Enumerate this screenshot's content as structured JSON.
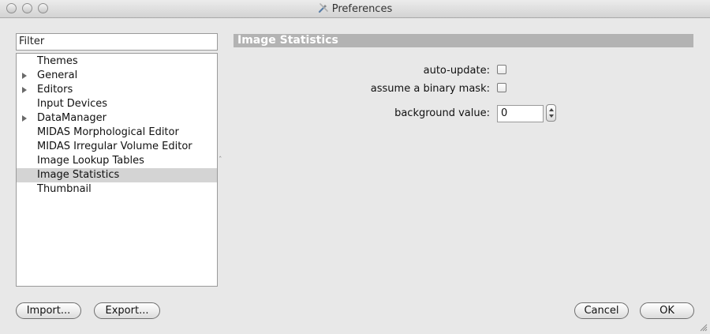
{
  "window": {
    "title": "Preferences"
  },
  "sidebar": {
    "filter_placeholder": "Filter",
    "items": [
      {
        "label": "Themes",
        "expandable": false,
        "selected": false
      },
      {
        "label": "General",
        "expandable": true,
        "selected": false
      },
      {
        "label": "Editors",
        "expandable": true,
        "selected": false
      },
      {
        "label": "Input Devices",
        "expandable": false,
        "selected": false
      },
      {
        "label": "DataManager",
        "expandable": true,
        "selected": false
      },
      {
        "label": "MIDAS Morphological Editor",
        "expandable": false,
        "selected": false
      },
      {
        "label": "MIDAS Irregular Volume Editor",
        "expandable": false,
        "selected": false
      },
      {
        "label": "Image Lookup Tables",
        "expandable": false,
        "selected": false
      },
      {
        "label": "Image Statistics",
        "expandable": false,
        "selected": true
      },
      {
        "label": "Thumbnail",
        "expandable": false,
        "selected": false
      }
    ]
  },
  "panel": {
    "title": "Image Statistics",
    "auto_update_label": "auto-update:",
    "auto_update_checked": false,
    "binary_mask_label": "assume a binary mask:",
    "binary_mask_checked": false,
    "background_value_label": "background value:",
    "background_value": "0"
  },
  "footer": {
    "import_label": "Import...",
    "export_label": "Export...",
    "cancel_label": "Cancel",
    "ok_label": "OK"
  }
}
